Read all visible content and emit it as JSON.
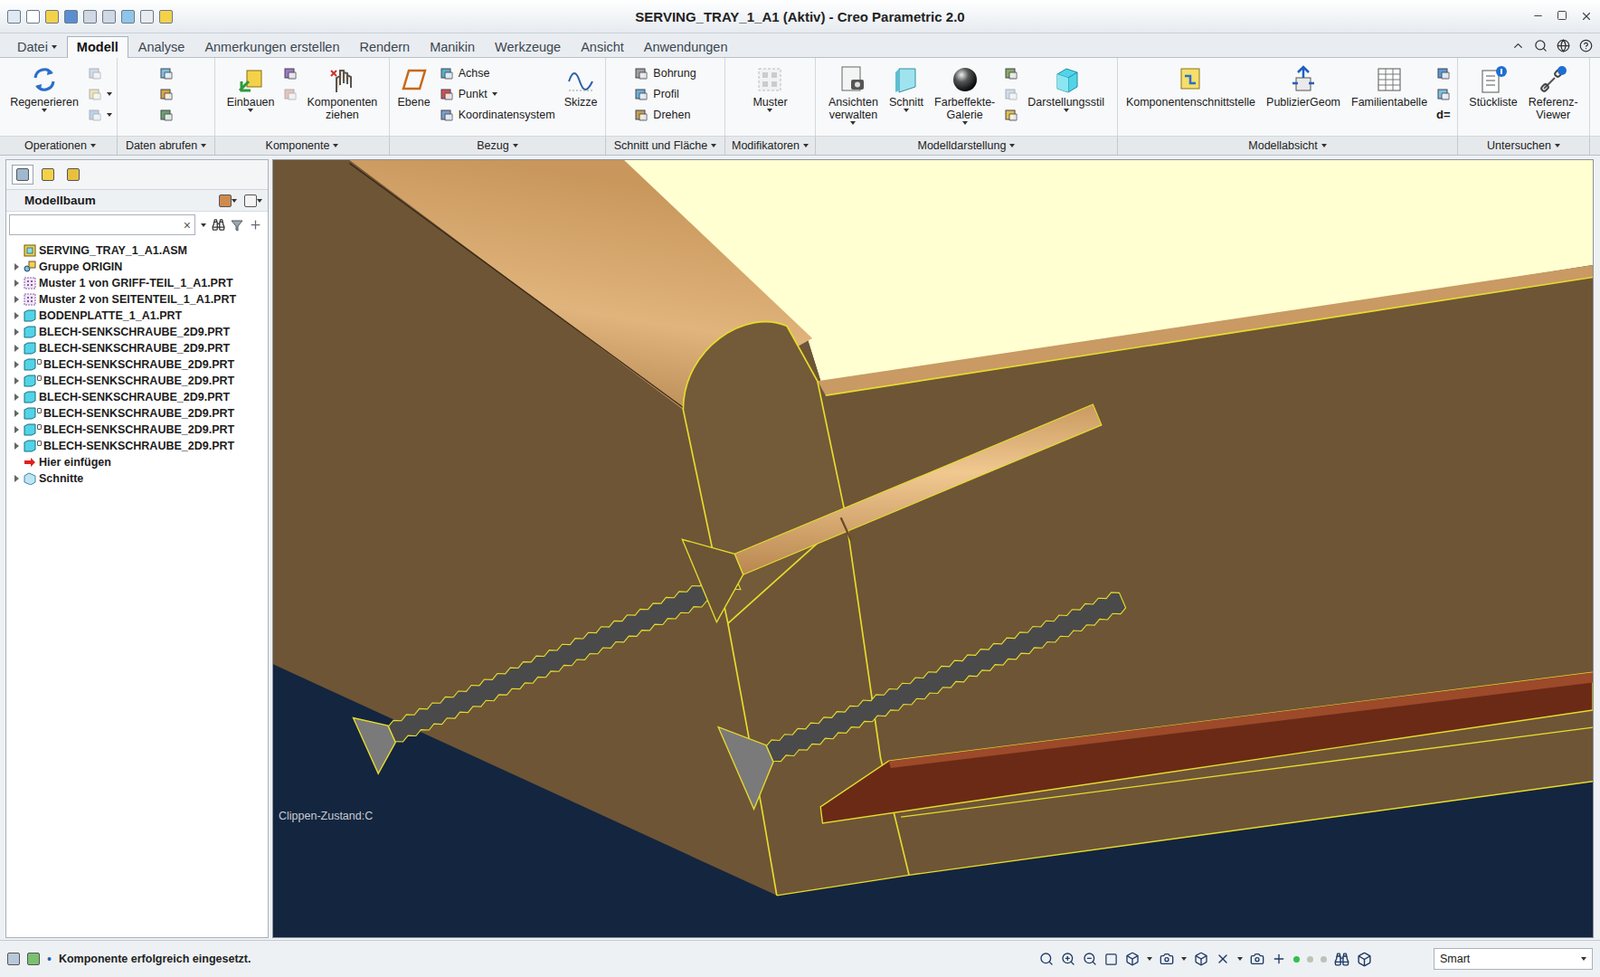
{
  "window": {
    "title": "SERVING_TRAY_1_A1 (Aktiv) - Creo Parametric 2.0"
  },
  "tabs": [
    {
      "label": "Datei",
      "selected": false,
      "dropdown": true
    },
    {
      "label": "Modell",
      "selected": true,
      "dropdown": false
    },
    {
      "label": "Analyse",
      "selected": false,
      "dropdown": false
    },
    {
      "label": "Anmerkungen erstellen",
      "selected": false,
      "dropdown": false
    },
    {
      "label": "Rendern",
      "selected": false,
      "dropdown": false
    },
    {
      "label": "Manikin",
      "selected": false,
      "dropdown": false
    },
    {
      "label": "Werkzeuge",
      "selected": false,
      "dropdown": false
    },
    {
      "label": "Ansicht",
      "selected": false,
      "dropdown": false
    },
    {
      "label": "Anwendungen",
      "selected": false,
      "dropdown": false
    }
  ],
  "ribbon": {
    "groups": [
      {
        "label": "Operationen",
        "dropdown": true,
        "items": [
          {
            "kind": "large",
            "lines": [
              "Regenerieren"
            ],
            "dropdown": true
          },
          {
            "kind": "stack",
            "tools": [
              {
                "kind": "icon",
                "disabled": true
              },
              {
                "kind": "icon",
                "disabled": true,
                "dropdown": true
              },
              {
                "kind": "icon",
                "disabled": true,
                "dropdown": true
              }
            ]
          }
        ]
      },
      {
        "label": "Daten abrufen",
        "dropdown": true,
        "items": [
          {
            "kind": "stack",
            "tools": [
              {
                "kind": "icon",
                "disabled": false
              },
              {
                "kind": "icon",
                "disabled": false
              },
              {
                "kind": "icon",
                "disabled": false
              }
            ]
          }
        ]
      },
      {
        "label": "Komponente",
        "dropdown": true,
        "items": [
          {
            "kind": "large",
            "lines": [
              "Einbauen"
            ],
            "dropdown": true
          },
          {
            "kind": "stack",
            "tools": [
              {
                "kind": "icon",
                "disabled": false
              },
              {
                "kind": "icon",
                "disabled": true
              }
            ]
          },
          {
            "kind": "large",
            "lines": [
              "Komponenten",
              "ziehen"
            ],
            "dropdown": false
          }
        ]
      },
      {
        "label": "Bezug",
        "dropdown": true,
        "items": [
          {
            "kind": "large",
            "lines": [
              "Ebene"
            ],
            "dropdown": false
          },
          {
            "kind": "stack",
            "tools": [
              {
                "kind": "small",
                "label": "Achse",
                "dropdown": false
              },
              {
                "kind": "small",
                "label": "Punkt",
                "dropdown": true
              },
              {
                "kind": "small",
                "label": "Koordinatensystem",
                "dropdown": false
              }
            ]
          },
          {
            "kind": "large",
            "lines": [
              "Skizze"
            ],
            "dropdown": false
          }
        ]
      },
      {
        "label": "Schnitt und Fläche",
        "dropdown": true,
        "items": [
          {
            "kind": "stack",
            "tools": [
              {
                "kind": "small",
                "label": "Bohrung",
                "dropdown": false
              },
              {
                "kind": "small",
                "label": "Profil",
                "dropdown": false
              },
              {
                "kind": "small",
                "label": "Drehen",
                "dropdown": false
              }
            ]
          }
        ]
      },
      {
        "label": "Modifikatoren",
        "dropdown": true,
        "items": [
          {
            "kind": "large",
            "lines": [
              "Muster"
            ],
            "dropdown": true
          }
        ]
      },
      {
        "label": "Modelldarstellung",
        "dropdown": true,
        "items": [
          {
            "kind": "large",
            "lines": [
              "Ansichten",
              "verwalten"
            ],
            "dropdown": true
          },
          {
            "kind": "large",
            "lines": [
              "Schnitt"
            ],
            "dropdown": true
          },
          {
            "kind": "large",
            "lines": [
              "Farbeffekte-",
              "Galerie"
            ],
            "dropdown": true
          },
          {
            "kind": "stack",
            "tools": [
              {
                "kind": "icon",
                "disabled": false
              },
              {
                "kind": "icon",
                "disabled": true
              },
              {
                "kind": "icon",
                "disabled": false
              }
            ]
          },
          {
            "kind": "large",
            "lines": [
              "Darstellungsstil"
            ],
            "dropdown": true
          }
        ]
      },
      {
        "label": "Modellabsicht",
        "dropdown": true,
        "items": [
          {
            "kind": "large",
            "lines": [
              "Komponentenschnittstelle"
            ],
            "dropdown": false
          },
          {
            "kind": "large",
            "lines": [
              "PublizierGeom"
            ],
            "dropdown": false
          },
          {
            "kind": "large",
            "lines": [
              "Familientabelle"
            ],
            "dropdown": false
          },
          {
            "kind": "stack",
            "tools": [
              {
                "kind": "icon",
                "disabled": false
              },
              {
                "kind": "icon",
                "disabled": false
              },
              {
                "kind": "small",
                "label": "d=",
                "dropdown": false,
                "noicon": true
              }
            ]
          }
        ]
      },
      {
        "label": "Untersuchen",
        "dropdown": true,
        "items": [
          {
            "kind": "large",
            "lines": [
              "Stückliste"
            ],
            "dropdown": false
          },
          {
            "kind": "large",
            "lines": [
              "Referenz-",
              "Viewer"
            ],
            "dropdown": false
          }
        ]
      }
    ]
  },
  "model_tree": {
    "panel_tabs": [
      {
        "selected": true
      },
      {
        "selected": false
      },
      {
        "selected": false
      }
    ],
    "title": "Modellbaum",
    "search": {
      "value": "",
      "clear": "×"
    },
    "items": [
      {
        "label": "SERVING_TRAY_1_A1.ASM",
        "kind": "assembly",
        "expander": false,
        "marked": false
      },
      {
        "label": "Gruppe ORIGIN",
        "kind": "group",
        "expander": true,
        "marked": false
      },
      {
        "label": "Muster 1 von GRIFF-TEIL_1_A1.PRT",
        "kind": "pattern",
        "expander": true,
        "marked": false
      },
      {
        "label": "Muster 2 von SEITENTEIL_1_A1.PRT",
        "kind": "pattern",
        "expander": true,
        "marked": false
      },
      {
        "label": "BODENPLATTE_1_A1.PRT",
        "kind": "part",
        "expander": true,
        "marked": false
      },
      {
        "label": "BLECH-SENKSCHRAUBE_2D9.PRT",
        "kind": "part",
        "expander": true,
        "marked": false
      },
      {
        "label": "BLECH-SENKSCHRAUBE_2D9.PRT",
        "kind": "part",
        "expander": true,
        "marked": false
      },
      {
        "label": "BLECH-SENKSCHRAUBE_2D9.PRT",
        "kind": "part",
        "expander": true,
        "marked": true
      },
      {
        "label": "BLECH-SENKSCHRAUBE_2D9.PRT",
        "kind": "part",
        "expander": true,
        "marked": true
      },
      {
        "label": "BLECH-SENKSCHRAUBE_2D9.PRT",
        "kind": "part",
        "expander": true,
        "marked": false
      },
      {
        "label": "BLECH-SENKSCHRAUBE_2D9.PRT",
        "kind": "part",
        "expander": true,
        "marked": true
      },
      {
        "label": "BLECH-SENKSCHRAUBE_2D9.PRT",
        "kind": "part",
        "expander": true,
        "marked": true
      },
      {
        "label": "BLECH-SENKSCHRAUBE_2D9.PRT",
        "kind": "part",
        "expander": true,
        "marked": true
      },
      {
        "label": "Hier einfügen",
        "kind": "insert",
        "expander": false,
        "marked": false
      },
      {
        "label": "Schnitte",
        "kind": "folder",
        "expander": true,
        "marked": false
      }
    ]
  },
  "viewport": {
    "clip_state": "Clippen-Zustand:C"
  },
  "status_bar": {
    "bullet": "•",
    "message": "Komponente erfolgreich eingesetzt.",
    "selection_filter": "Smart"
  }
}
